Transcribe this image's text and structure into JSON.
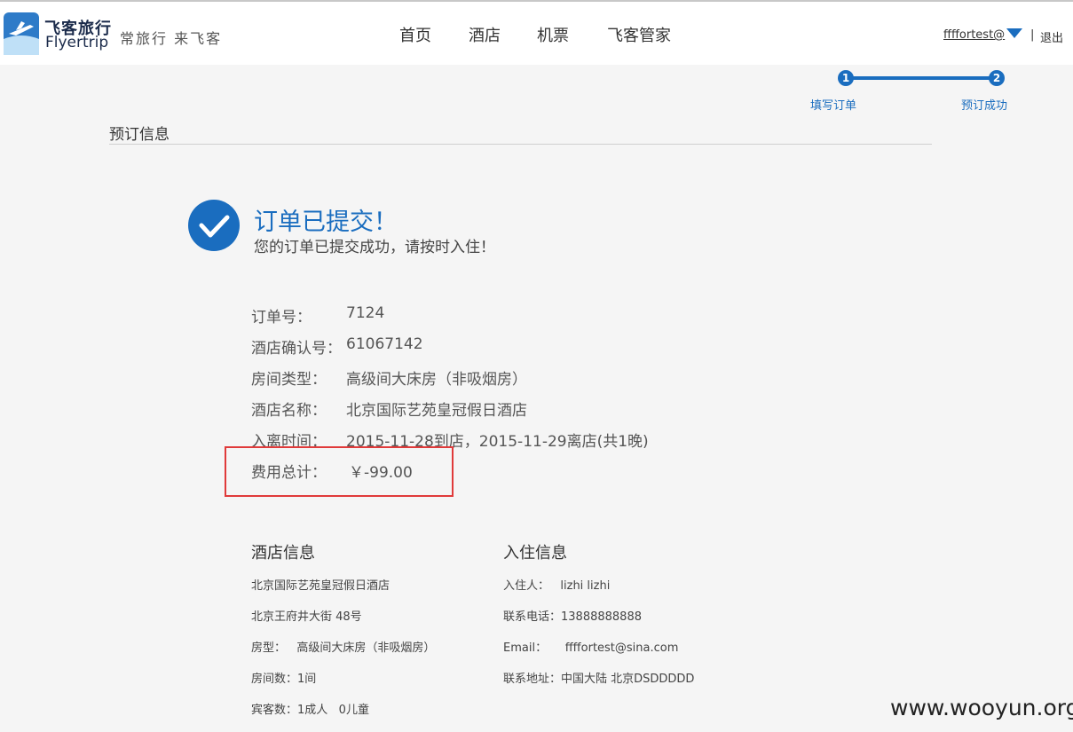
{
  "header": {
    "brand_cn": "飞客旅行",
    "brand_en": "Flyertrip",
    "slogan": "常旅行 来飞客",
    "nav": [
      "首页",
      "酒店",
      "机票",
      "飞客管家"
    ],
    "user": "ffffortest@",
    "separator": "|",
    "logout": "退出"
  },
  "steps": [
    {
      "number": "1",
      "label": "填写订单"
    },
    {
      "number": "2",
      "label": "预订成功"
    }
  ],
  "section_title": "预订信息",
  "success": {
    "title": "订单已提交！",
    "subtitle": "您的订单已提交成功，请按时入住！"
  },
  "order": {
    "order_no_label": "订单号：",
    "order_no": "7124",
    "confirm_label": "酒店确认号：",
    "confirm": "61067142",
    "room_type_label": "房间类型：",
    "room_type": "高级间大床房（非吸烟房）",
    "hotel_name_label": "酒店名称：",
    "hotel_name": "北京国际艺苑皇冠假日酒店",
    "dates_label": "入离时间：",
    "dates": "2015-11-28到店，2015-11-29离店(共1晚)",
    "total_label": "费用总计：",
    "total": "￥-99.00"
  },
  "hotel_info": {
    "title": "酒店信息",
    "name": "北京国际艺苑皇冠假日酒店",
    "address": "北京王府井大街 48号",
    "room_type": "房型：   高级间大床房（非吸烟房）",
    "rooms": "房间数：1间",
    "guests": "宾客数：1成人   0儿童"
  },
  "guest_info": {
    "title": "入住信息",
    "guest": "入住人：   lizhi lizhi",
    "phone": "联系电话：13888888888",
    "email": "Email：     ffffortest@sina.com",
    "address": "联系地址：中国大陆 北京DSDDDDD"
  },
  "watermark": "www.wooyun.org",
  "colors": {
    "accent": "#1a6dbf",
    "highlight": "#e03a3a"
  }
}
